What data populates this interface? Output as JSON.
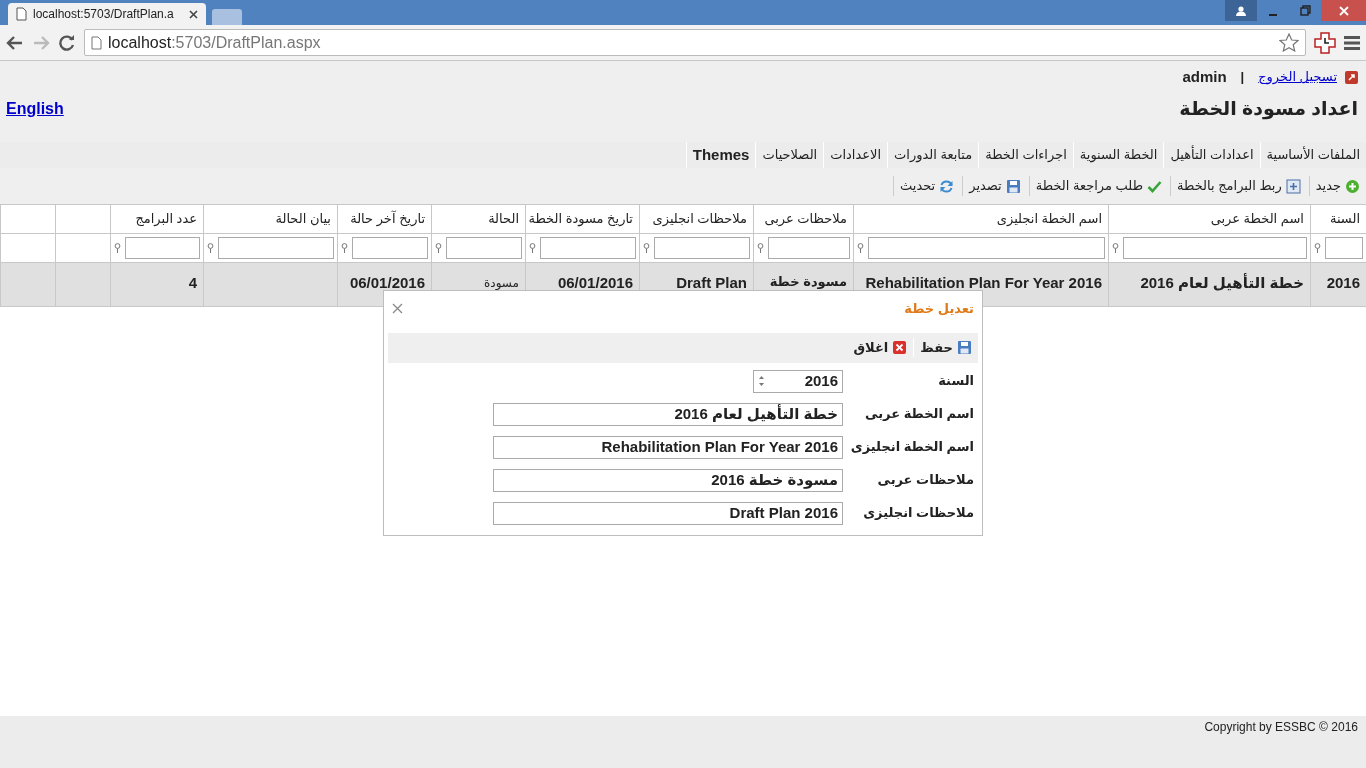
{
  "browser": {
    "tab_title": "localhost:5703/DraftPlan.a",
    "url_host": "localhost",
    "url_path": ":5703/DraftPlan.aspx"
  },
  "header": {
    "logout": "تسجيل الخروج",
    "separator": "|",
    "user": "admin",
    "language_link": "English",
    "title": "اعداد مسودة الخطة"
  },
  "menu": [
    "الملفات الأساسية",
    "اعدادات التأهيل",
    "الخطة السنوية",
    "اجراءات الخطة",
    "متابعة الدورات",
    "الاعدادات",
    "الصلاحيات",
    "Themes"
  ],
  "toolbar": [
    {
      "label": "جديد"
    },
    {
      "label": "ربط البرامج بالخطة"
    },
    {
      "label": "طلب مراجعة الخطة"
    },
    {
      "label": "تصدير"
    },
    {
      "label": "تحديث"
    }
  ],
  "grid": {
    "columns": [
      "السنة",
      "اسم الخطة عربى",
      "اسم الخطة انجليزى",
      "ملاحظات عربى",
      "ملاحظات انجليزى",
      "تاريخ مسودة الخطة",
      "الحالة",
      "تاريخ آخر حالة",
      "بيان الحالة",
      "عدد البرامج"
    ],
    "rows": [
      {
        "selected": true,
        "cells": [
          "2016",
          "خطة التأهيل لعام 2016",
          "Rehabilitation Plan For Year 2016",
          "مسودة خطة",
          "Draft Plan",
          "06/01/2016",
          "مسودة",
          "06/01/2016",
          "",
          "4"
        ]
      }
    ]
  },
  "dialog": {
    "title": "تعديل خطة",
    "buttons": [
      {
        "label": "حفظ"
      },
      {
        "label": "اغلاق"
      }
    ],
    "fields": [
      {
        "label": "السنة",
        "value": "2016",
        "kind": "spin"
      },
      {
        "label": "اسم الخطة عربى",
        "value": "خطة التأهيل لعام 2016",
        "kind": "text"
      },
      {
        "label": "اسم الخطة انجليزى",
        "value": "Rehabilitation Plan For Year 2016",
        "kind": "text"
      },
      {
        "label": "ملاحظات عربى",
        "value": "مسودة خطة 2016",
        "kind": "text"
      },
      {
        "label": "ملاحظات انجليزى",
        "value": "Draft Plan 2016",
        "kind": "text"
      }
    ]
  },
  "footer": {
    "copyright": "Copyright by ESSBC © 2016"
  }
}
